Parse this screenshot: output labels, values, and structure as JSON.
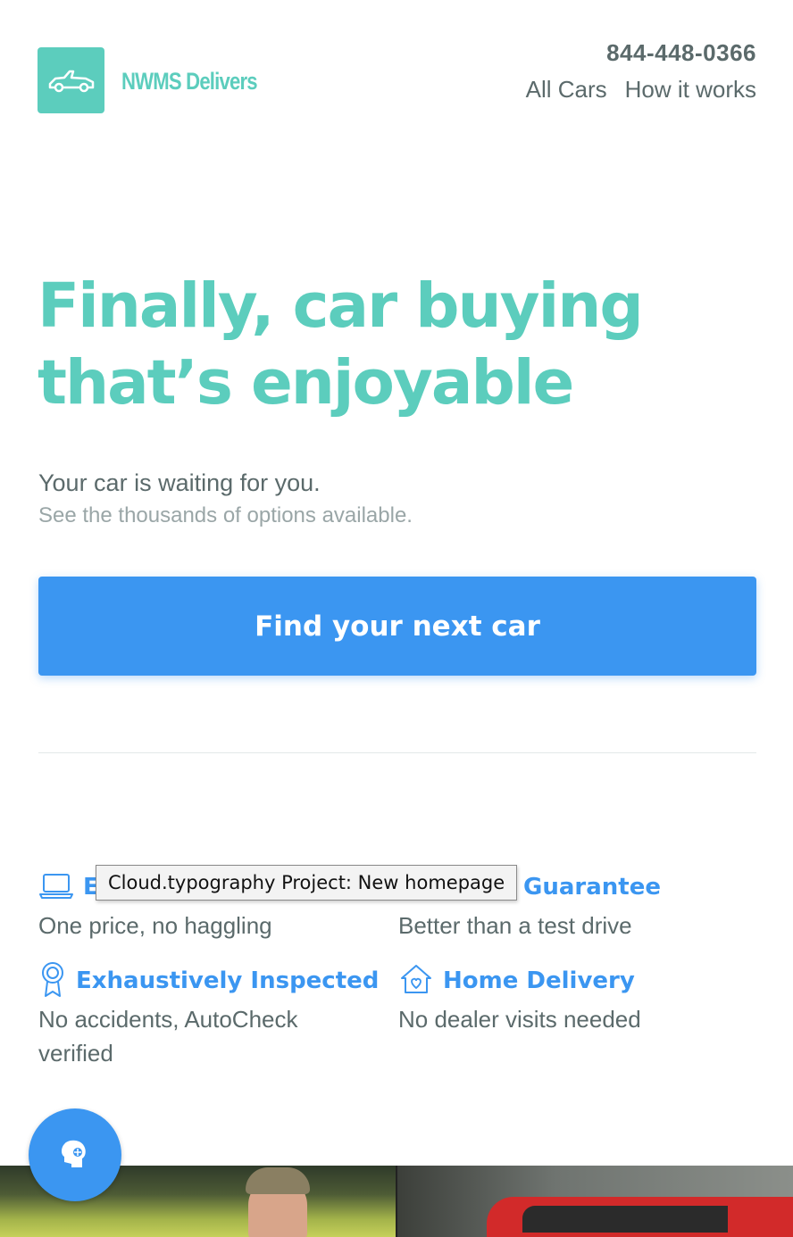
{
  "header": {
    "brand": "NWMS Delivers",
    "phone": "844-448-0366",
    "nav": [
      {
        "label": "All Cars"
      },
      {
        "label": "How it works"
      }
    ]
  },
  "hero": {
    "title_line1": "Finally, car buying",
    "title_line2": "that’s enjoyable",
    "subtitle": "Your car is waiting for you.",
    "subsubtitle": "See the thousands of options available.",
    "cta_label": "Find your next car"
  },
  "features": [
    {
      "icon": "laptop-icon",
      "title": "E",
      "desc": "One price, no haggling"
    },
    {
      "icon": "calendar-icon",
      "title": "Guarantee",
      "desc": "Better than a test drive"
    },
    {
      "icon": "award-ribbon-icon",
      "title": "Exhaustively Inspected",
      "desc": "No accidents, AutoCheck verified"
    },
    {
      "icon": "home-heart-icon",
      "title": "Home Delivery",
      "desc": "No dealer visits needed"
    }
  ],
  "tooltip": "Cloud.typography Project: New homepage",
  "colors": {
    "accent": "#5ccdbd",
    "primary": "#3b96f1",
    "text": "#5b6a6b",
    "muted": "#9aa6a7"
  }
}
